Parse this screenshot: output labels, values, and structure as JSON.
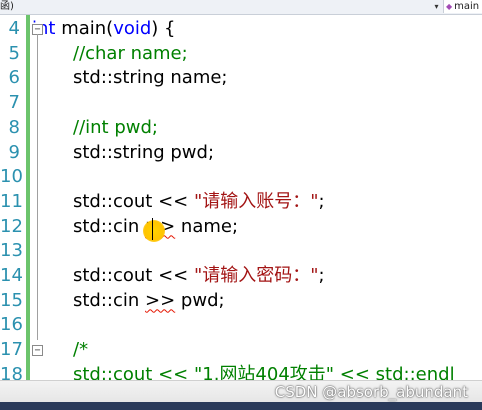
{
  "top_bar": {
    "left_text": "函)",
    "right_text": "main",
    "dropdown_arrow": "▾"
  },
  "lines": [
    {
      "num": "4",
      "parts": [
        {
          "t": "int",
          "c": "kw"
        },
        {
          "t": " main(",
          "c": ""
        },
        {
          "t": "void",
          "c": "kw"
        },
        {
          "t": ") {",
          "c": ""
        }
      ],
      "fold": "⊟"
    },
    {
      "num": "5",
      "parts": [
        {
          "t": "//char name;",
          "c": "cm"
        }
      ]
    },
    {
      "num": "6",
      "parts": [
        {
          "t": "std::string name;",
          "c": ""
        }
      ]
    },
    {
      "num": "7",
      "parts": []
    },
    {
      "num": "8",
      "parts": [
        {
          "t": "//int pwd;",
          "c": "cm"
        }
      ]
    },
    {
      "num": "9",
      "parts": [
        {
          "t": "std::string pwd;",
          "c": ""
        }
      ]
    },
    {
      "num": "10",
      "parts": []
    },
    {
      "num": "11",
      "parts": [
        {
          "t": "std::cout << ",
          "c": ""
        },
        {
          "t": "\"请输入账号：\"",
          "c": "st"
        },
        {
          "t": ";",
          "c": ""
        }
      ]
    },
    {
      "num": "12",
      "parts": [
        {
          "t": "std::cin ",
          "c": ""
        },
        {
          "t": ">>",
          "c": "squig"
        },
        {
          "t": " name;",
          "c": ""
        }
      ]
    },
    {
      "num": "13",
      "parts": []
    },
    {
      "num": "14",
      "parts": [
        {
          "t": "std::cout << ",
          "c": ""
        },
        {
          "t": "\"请输入密码：\"",
          "c": "st"
        },
        {
          "t": ";",
          "c": ""
        }
      ]
    },
    {
      "num": "15",
      "parts": [
        {
          "t": "std::cin ",
          "c": ""
        },
        {
          "t": ">>",
          "c": "squig"
        },
        {
          "t": " pwd;",
          "c": ""
        }
      ]
    },
    {
      "num": "16",
      "parts": []
    },
    {
      "num": "17",
      "parts": [
        {
          "t": "/*",
          "c": "cm"
        }
      ],
      "fold": "⊟"
    },
    {
      "num": "18",
      "parts": [
        {
          "t": "std::cout << ",
          "c": "cm"
        },
        {
          "t": "\"1.网站404攻击\" << std::endl",
          "c": "cm"
        }
      ]
    }
  ],
  "watermark": "CSDN @absorb_abundant",
  "colors": {
    "keyword": "#0000ff",
    "comment": "#008000",
    "string": "#a31515",
    "line_number": "#2b91af",
    "change_margin": "#6cc46c"
  }
}
